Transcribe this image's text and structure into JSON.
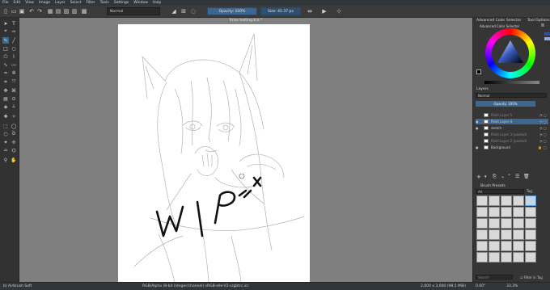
{
  "menubar": {
    "items": [
      "File",
      "Edit",
      "View",
      "Image",
      "Layer",
      "Select",
      "Filter",
      "Tools",
      "Settings",
      "Window",
      "Help"
    ]
  },
  "toolbar": {
    "blend_mode": "Normal",
    "opacity_label": "Opacity: 100%",
    "size_label": "Size: 45.37 px"
  },
  "canvas": {
    "document_title": "frnas testing.kra *",
    "wip_text": "WIP"
  },
  "docker": {
    "color_panel_title": "Advanced Color Selector",
    "tool_options_tab": "Tool Options",
    "color_subtitle": "Advanced Color Selector",
    "layers_title": "Layers",
    "layers_blend_mode": "Normal",
    "layers_opacity": "Opacity: 100%",
    "layers": [
      {
        "name": "Paint Layer 5",
        "active": false
      },
      {
        "name": "Paint Layer 4",
        "active": true
      },
      {
        "name": "sketch",
        "active": false
      },
      {
        "name": "Paint Layer 3 (pasted)",
        "active": false
      },
      {
        "name": "Paint Layer 2 (pasted)",
        "active": false
      },
      {
        "name": "Background",
        "active": false
      }
    ],
    "brush_presets_title": "Brush Presets",
    "brush_filter": "All",
    "brush_tag": "Tag",
    "search_placeholder": "Search",
    "filter_in_tag": "Filter in Tag"
  },
  "statusbar": {
    "brush_name": "b) Airbrush Soft",
    "color_info": "RGB/Alpha (8-bit integer/channel) sRGB-elle-V2-srgbtrc.icc",
    "dimensions": "2,000 x 3,000 (98.5 MiB)",
    "rotation": "0.00°",
    "zoom": "33.3%"
  },
  "colors": {
    "accent": "#3d6690",
    "canvas_bg": "#7f7f7f",
    "panel_bg": "#353535"
  }
}
